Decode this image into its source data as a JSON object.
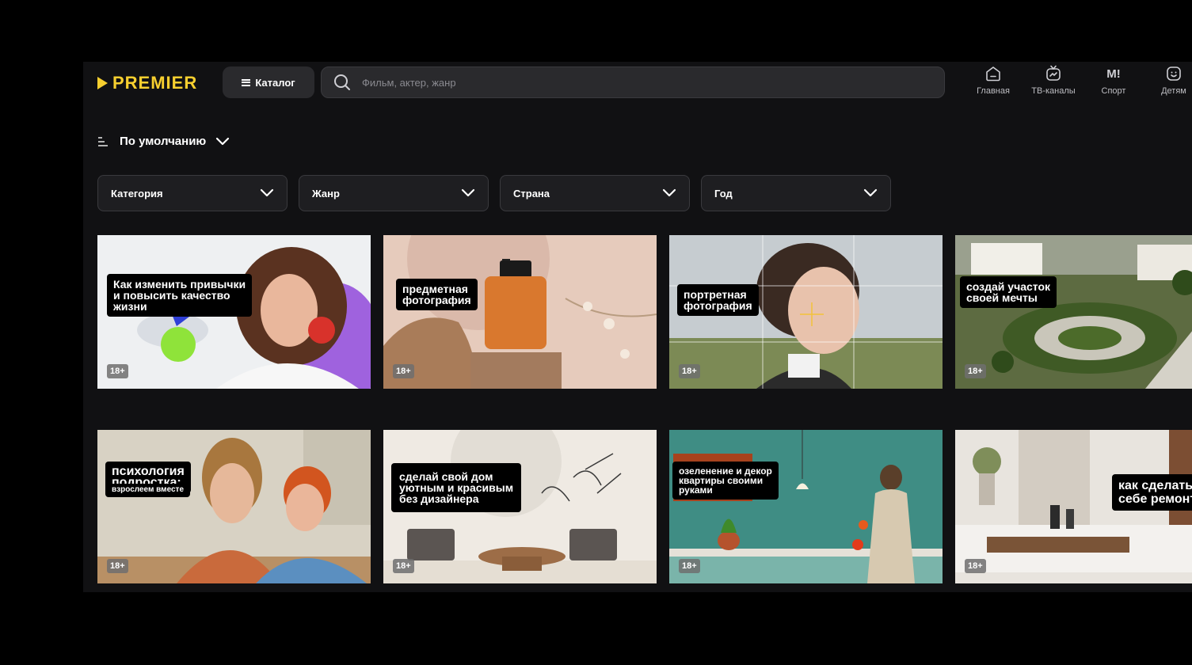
{
  "header": {
    "logo_text": "PREMIER",
    "catalog_label": "Каталог",
    "search_placeholder": "Фильм, актер, жанр",
    "nav": [
      {
        "label": "Главная",
        "icon": "home-icon"
      },
      {
        "label": "ТВ-каналы",
        "icon": "tv-icon"
      },
      {
        "label": "Спорт",
        "icon": "sport-icon",
        "glyph": "M!"
      },
      {
        "label": "Детям",
        "icon": "kids-icon"
      }
    ]
  },
  "sort": {
    "label": "По умолчанию"
  },
  "filters": [
    {
      "label": "Категория"
    },
    {
      "label": "Жанр"
    },
    {
      "label": "Страна"
    },
    {
      "label": "Год"
    }
  ],
  "cards": [
    {
      "caption": "Как изменить привычки\nи повысить качество\nжизни",
      "age": "18+"
    },
    {
      "caption": "предметная\nфотография",
      "age": "18+"
    },
    {
      "caption": "портретная\nфотография",
      "age": "18+"
    },
    {
      "caption": "создай участок\nсвоей мечты",
      "age": "18+"
    },
    {
      "caption": "психология\nподростка:",
      "subcaption": "взрослеем вместе",
      "age": "18+"
    },
    {
      "caption": "сделай свой дом\nуютным и красивым\nбез дизайнера",
      "age": "18+"
    },
    {
      "caption": "озеленение и декор\nквартиры своими\nруками",
      "age": "18+"
    },
    {
      "caption": "как сделать\nсебе ремонт",
      "age": "18+"
    }
  ],
  "colors": {
    "accent": "#f7cf2f",
    "background": "#111113",
    "panel": "#2a2a2d"
  }
}
